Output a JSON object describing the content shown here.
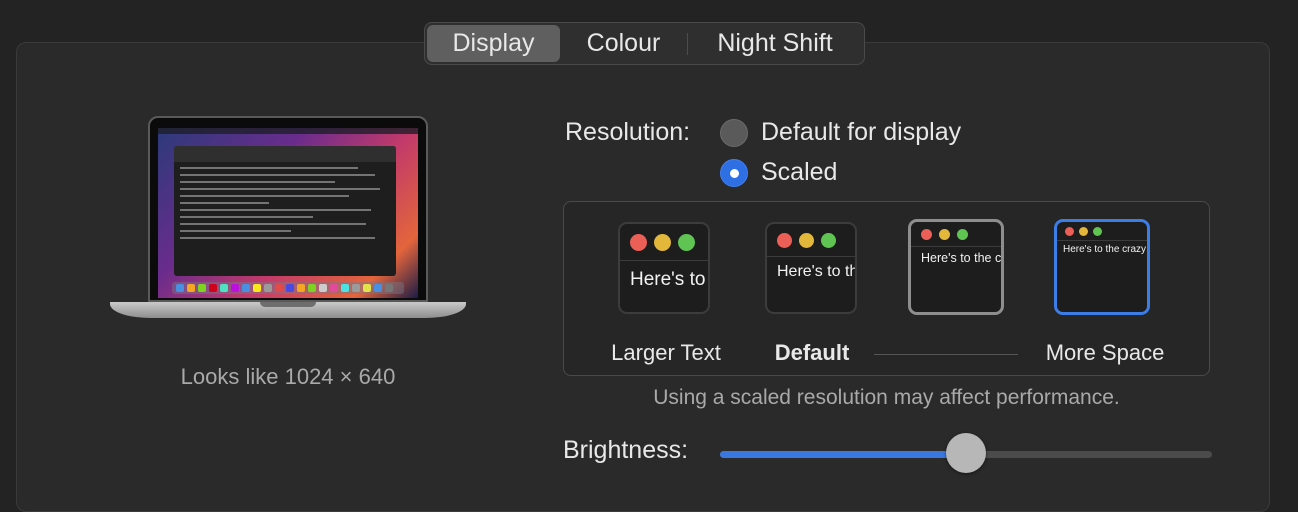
{
  "tabs": [
    {
      "label": "Display",
      "selected": true
    },
    {
      "label": "Colour",
      "selected": false
    },
    {
      "label": "Night Shift",
      "selected": false
    }
  ],
  "display_preview": {
    "looks_like": "Looks like 1024 × 640"
  },
  "resolution": {
    "label": "Resolution:",
    "options": [
      {
        "label": "Default for display",
        "selected": false
      },
      {
        "label": "Scaled",
        "selected": true
      }
    ]
  },
  "scaled_options": {
    "thumbnails": [
      {
        "preview_text": "Here's to the crazy ones, the misfits, the troublemakers",
        "selected": false
      },
      {
        "preview_text": "Here's to the crazy ones, the troublemakers, the ones who",
        "selected": false
      },
      {
        "preview_text": "Here's to the crazy ones, the troublemakers. The ones who see things differently. They're not fond of rules. And they",
        "selected": false
      },
      {
        "preview_text": "Here's to the crazy ones, the troublemakers. The ones who see things differently. They're not fond of rules. And they have no respect. You can quote them, disagree with them. About the only thing you can't do is ignore them. Because they change things.",
        "selected": true
      }
    ],
    "labels": {
      "larger": "Larger Text",
      "default": "Default",
      "more": "More Space"
    },
    "performance_note": "Using a scaled resolution may affect performance."
  },
  "brightness": {
    "label": "Brightness:",
    "value": 0.5
  },
  "colors": {
    "accent": "#3a78e0",
    "window_background": "#232323"
  }
}
